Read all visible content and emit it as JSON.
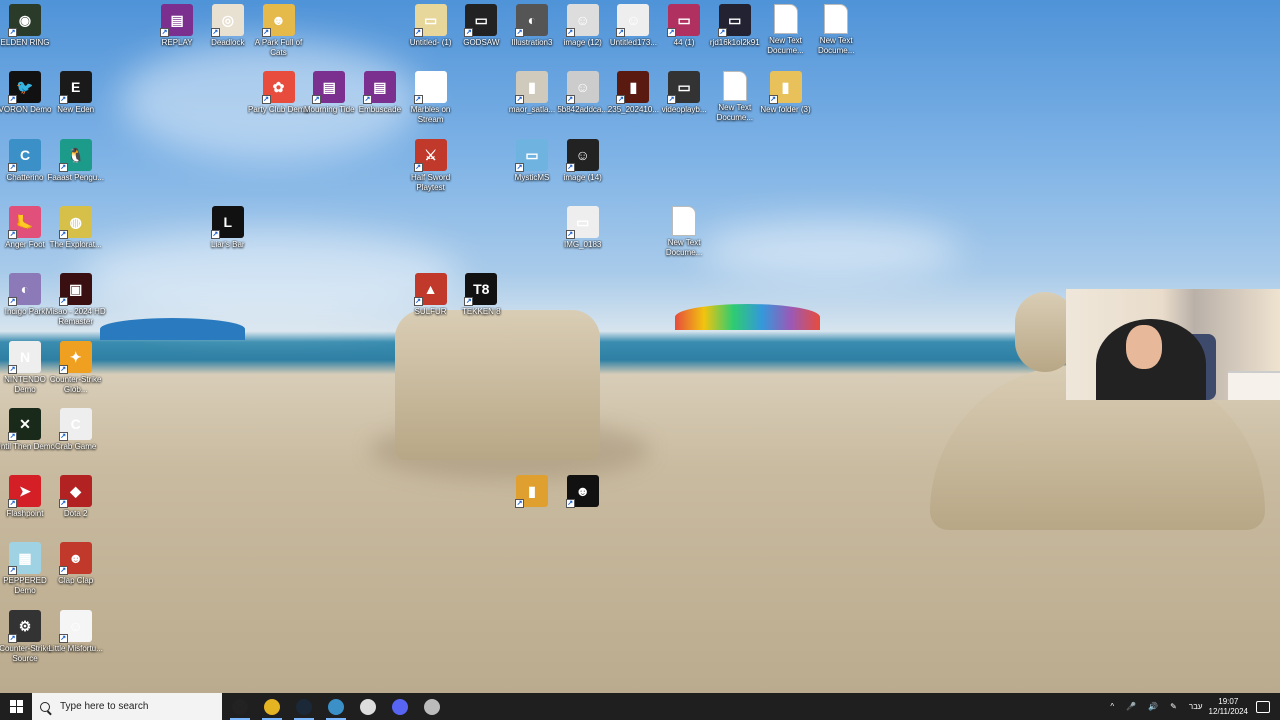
{
  "desktop": {
    "icons": [
      {
        "label": "ELDEN RING",
        "color": "#2b3b2a",
        "glyph": "◉"
      },
      {
        "label": "VORON Demo",
        "color": "#111",
        "glyph": "🐦"
      },
      {
        "label": "Chatterino",
        "color": "#3b90c8",
        "glyph": "C"
      },
      {
        "label": "Anger Foot",
        "color": "#e0507a",
        "glyph": "🦶"
      },
      {
        "label": "Indigo Park",
        "color": "#8c7ab8",
        "glyph": "◐"
      },
      {
        "label": "NINTENDO Demo",
        "color": "#eee",
        "glyph": "N"
      },
      {
        "label": "Until Then Demo",
        "color": "#1a2a1a",
        "glyph": "✕"
      },
      {
        "label": "Flashpoint",
        "color": "#d41f26",
        "glyph": "➤"
      },
      {
        "label": "PEPPERED Demo",
        "color": "#9fd2e2",
        "glyph": "▦"
      },
      {
        "label": "Counter-Strike Source",
        "color": "#333",
        "glyph": "⚙"
      },
      {
        "label": "New Eden",
        "color": "#1a1a1a",
        "glyph": "E"
      },
      {
        "label": "Faaast Pengu...",
        "color": "#1d9b8a",
        "glyph": "🐧"
      },
      {
        "label": "The Explorat...",
        "color": "#d6c04a",
        "glyph": "◍"
      },
      {
        "label": "Misao - 2024 HD Remaster",
        "color": "#3a0f12",
        "glyph": "▣"
      },
      {
        "label": "Counter-Strike Glob...",
        "color": "#f0a020",
        "glyph": "✦"
      },
      {
        "label": "Crab Game",
        "color": "#eee",
        "glyph": "C"
      },
      {
        "label": "Dota 2",
        "color": "#b22222",
        "glyph": "◆"
      },
      {
        "label": "Clap Clap",
        "color": "#c0392b",
        "glyph": "☻"
      },
      {
        "label": "Little Misfortu...",
        "color": "#f5f5f5",
        "glyph": "☺"
      },
      {
        "label": "REPLAY",
        "color": "#7b2f8e",
        "glyph": "▤"
      },
      {
        "label": "Deadlock",
        "color": "#e8e0d0",
        "glyph": "◎"
      },
      {
        "label": "Liar's Bar",
        "color": "#111",
        "glyph": "L"
      },
      {
        "label": "A Park Full of Cats",
        "color": "#e5b94a",
        "glyph": "☻"
      },
      {
        "label": "Party Club Demo",
        "color": "#e74c3c",
        "glyph": "✿"
      },
      {
        "label": "Mourning Tide",
        "color": "#7b2f8e",
        "glyph": "▤"
      },
      {
        "label": "Embuscade",
        "color": "#7b2f8e",
        "glyph": "▤"
      },
      {
        "label": "Marbles on Stream",
        "color": "#fff",
        "glyph": "○"
      },
      {
        "label": "Half Sword Playtest",
        "color": "#c0392b",
        "glyph": "⚔"
      },
      {
        "label": "SULFUR",
        "color": "#c0392b",
        "glyph": "▲"
      },
      {
        "label": "Untitled- (1)",
        "color": "#e8d79a",
        "glyph": "▭"
      },
      {
        "label": "GODSAW",
        "color": "#222",
        "glyph": "▭"
      },
      {
        "label": "TEKKEN 8",
        "color": "#111",
        "glyph": "T8"
      },
      {
        "label": "Illustration3",
        "color": "#555",
        "glyph": "◐"
      },
      {
        "label": "maor_satla...",
        "color": "#cfcabb",
        "glyph": "▮"
      },
      {
        "label": "MysticMS",
        "color": "#6fb3e0",
        "glyph": "▭"
      },
      {
        "label": "image (12)",
        "color": "#ddd",
        "glyph": "☺"
      },
      {
        "label": "5b842addca...",
        "color": "#ccc",
        "glyph": "☺"
      },
      {
        "label": "image (14)",
        "color": "#222",
        "glyph": "☺"
      },
      {
        "label": "IMG_0183",
        "color": "#eee",
        "glyph": "▭"
      },
      {
        "label": "Untitled173...",
        "color": "#eee",
        "glyph": "☺"
      },
      {
        "label": "235_202410...",
        "color": "#5a1a10",
        "glyph": "▮"
      },
      {
        "label": "44 (1)",
        "color": "#b03060",
        "glyph": "▭"
      },
      {
        "label": "videoplayb...",
        "color": "#333",
        "glyph": "▭"
      },
      {
        "label": "New Text Docume...",
        "color": "#fff",
        "glyph": ""
      },
      {
        "label": "rjd16k1ol2k91",
        "color": "#223",
        "glyph": "▭"
      },
      {
        "label": "New Text Docume...",
        "color": "#fff",
        "glyph": ""
      },
      {
        "label": "New Text Docume...",
        "color": "#fff",
        "glyph": ""
      },
      {
        "label": "New folder (3)",
        "color": "#e8c15a",
        "glyph": "▮"
      },
      {
        "label": "New Text Docume...",
        "color": "#fff",
        "glyph": ""
      },
      {
        "label": "",
        "color": "#e0a030",
        "glyph": "▮"
      },
      {
        "label": "",
        "color": "#111",
        "glyph": "☻"
      }
    ]
  },
  "taskbar": {
    "search_placeholder": "Type here to search",
    "apps": [
      {
        "name": "obs",
        "color": "#222"
      },
      {
        "name": "chrome",
        "color": "#e5b423"
      },
      {
        "name": "steam",
        "color": "#1b2838"
      },
      {
        "name": "chatterino",
        "color": "#3b90c8"
      },
      {
        "name": "notepad",
        "color": "#ddd"
      },
      {
        "name": "discord",
        "color": "#5865f2"
      },
      {
        "name": "app",
        "color": "#bbb"
      }
    ],
    "language": "עבר",
    "time": "19:07",
    "date": "12/11/2024"
  }
}
